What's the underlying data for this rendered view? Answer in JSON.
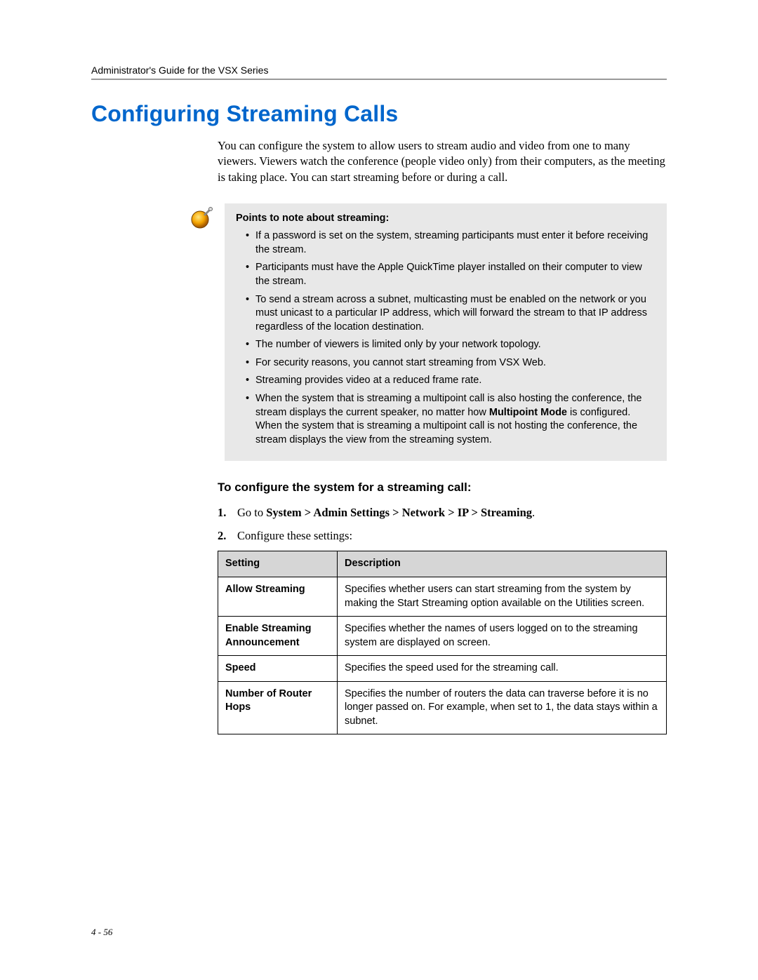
{
  "header": {
    "running_head": "Administrator's Guide for the VSX Series"
  },
  "title": "Configuring Streaming Calls",
  "intro": "You can configure the system to allow users to stream audio and video from one to many viewers. Viewers watch the conference (people video only) from their computers, as the meeting is taking place. You can start streaming before or during a call.",
  "note": {
    "title": "Points to note about streaming:",
    "items": [
      "If a password is set on the system, streaming participants must enter it before receiving the stream.",
      "Participants must have the Apple QuickTime player installed on their computer to view the stream.",
      "To send a stream across a subnet, multicasting must be enabled on the network or you must unicast to a particular IP address, which will forward the stream to that IP address regardless of the location destination.",
      "The number of viewers is limited only by your network topology.",
      "For security reasons, you cannot start streaming from VSX Web.",
      "Streaming provides video at a reduced frame rate."
    ],
    "last_item_pre": "When the system that is streaming a multipoint call is also hosting the conference, the stream displays the current speaker, no matter how ",
    "last_item_bold": "Multipoint Mode",
    "last_item_post": " is configured. When the system that is streaming a multipoint call is not hosting the conference, the stream displays the view from the streaming system."
  },
  "procedure": {
    "heading": "To configure the system for a streaming call:",
    "step1_pre": "Go to ",
    "step1_bold": "System > Admin Settings > Network > IP > Streaming",
    "step1_post": ".",
    "step2": "Configure these settings:"
  },
  "table": {
    "head_setting": "Setting",
    "head_desc": "Description",
    "rows": [
      {
        "setting": "Allow Streaming",
        "desc": "Specifies whether users can start streaming from the system by making the Start Streaming option available on the Utilities screen."
      },
      {
        "setting": "Enable Streaming Announcement",
        "desc": "Specifies whether the names of users logged on to the streaming system are displayed on screen."
      },
      {
        "setting": "Speed",
        "desc": "Specifies the speed used for the streaming call."
      },
      {
        "setting": "Number of Router Hops",
        "desc": "Specifies the number of routers the data can traverse before it is no longer passed on. For example, when set to 1, the data stays within a subnet."
      }
    ]
  },
  "page_number": "4 - 56"
}
